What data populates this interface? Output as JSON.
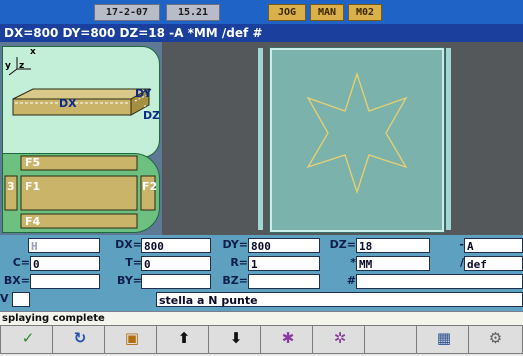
{
  "status": {
    "date": "17-2-07",
    "time": "15.21",
    "modes": [
      "JOG",
      "MAN",
      "M02"
    ]
  },
  "title": "DX=800 DY=800 DZ=18 -A *MM /def #",
  "axes": {
    "x": "x",
    "y": "y",
    "z": "z"
  },
  "dim_labels": {
    "dx": "DX",
    "dy": "DY",
    "dz": "DZ"
  },
  "face_labels": {
    "f5": "F5",
    "f1": "F1",
    "f2": "F2",
    "f4": "F4",
    "f3": "3"
  },
  "fields": {
    "h_label": "H",
    "dx_label": "DX=",
    "dx": "800",
    "dy_label": "DY=",
    "dy": "800",
    "dz_label": "DZ=",
    "dz": "18",
    "a_label": "-",
    "a": "A",
    "c_label": "C=",
    "c": "0",
    "t_label": "T=",
    "t": "0",
    "r_label": "R=",
    "r": "1",
    "mm_label": "*",
    "mm": "MM",
    "def_label": "/",
    "def": "def",
    "bx_label": "BX=",
    "bx": "",
    "by_label": "BY=",
    "by": "",
    "bz_label": "BZ=",
    "bz": "",
    "hash_label": "#",
    "hash": "",
    "v_label": "V",
    "description": "stella a N punte"
  },
  "message": "splaying complete",
  "softkeys": [
    {
      "icon": "check-icon",
      "glyph": "✓",
      "color": "#2c8a2c",
      "caption": ""
    },
    {
      "icon": "refresh-icon",
      "glyph": "↻",
      "color": "#1f4fb0",
      "caption": ""
    },
    {
      "icon": "import-icon",
      "glyph": "▣",
      "color": "#b06e10",
      "caption": ""
    },
    {
      "icon": "arrow-up-icon",
      "glyph": "⬆",
      "color": "#101010",
      "caption": ""
    },
    {
      "icon": "arrow-down-icon",
      "glyph": "⬇",
      "color": "#101010",
      "caption": ""
    },
    {
      "icon": "tool-icon",
      "glyph": "✱",
      "color": "#8a3aa0",
      "caption": ""
    },
    {
      "icon": "tool-alt-icon",
      "glyph": "✲",
      "color": "#8a3aa0",
      "caption": ""
    },
    {
      "icon": "blank-icon",
      "glyph": "",
      "color": "#101010",
      "caption": ""
    },
    {
      "icon": "calculator-icon",
      "glyph": "▦",
      "color": "#2a4e90",
      "caption": ""
    },
    {
      "icon": "config-icon",
      "glyph": "⚙",
      "color": "#606060",
      "caption": ""
    }
  ],
  "colors": {
    "status_bar": "#1f63c6",
    "title_bar": "#1a3f9c",
    "sheet": "#7cb2ac",
    "star": "#e8d070",
    "panel": "#5ea0bf"
  }
}
